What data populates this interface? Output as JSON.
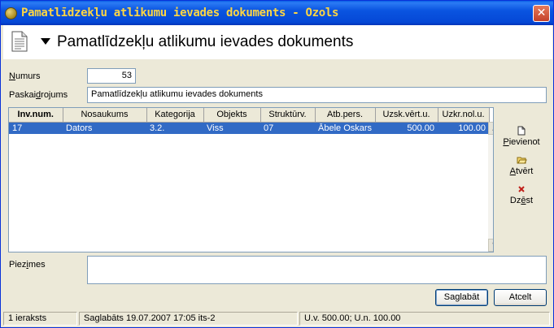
{
  "window": {
    "title": "Pamatlīdzekļu atlikumu ievades dokuments - Ozols",
    "close_glyph": "✕"
  },
  "header": {
    "heading": "Pamatlīdzekļu atlikumu ievades dokuments"
  },
  "form": {
    "numurs_label_pre": "",
    "numurs_label_u": "N",
    "numurs_label_post": "umurs",
    "numurs_value": "53",
    "paskaidrojums_label_pre": "Paskai",
    "paskaidrojums_label_u": "d",
    "paskaidrojums_label_post": "rojums",
    "paskaidrojums_value": "Pamatlīdzekļu atlikumu ievades dokuments",
    "piezimes_label_pre": "Piez",
    "piezimes_label_u": "i",
    "piezimes_label_post": "mes",
    "piezimes_value": ""
  },
  "grid": {
    "columns": [
      "Inv.num.",
      "Nosaukums",
      "Kategorija",
      "Objekts",
      "Struktūrv.",
      "Atb.pers.",
      "Uzsk.vērt.u.",
      "Uzkr.nol.u."
    ],
    "rows": [
      [
        "17",
        "Dators",
        "3.2.",
        "Viss",
        "07",
        "Ābele Oskars",
        "500.00",
        "100.00"
      ]
    ],
    "scroll_up": "▲",
    "scroll_down": "▼"
  },
  "toolbar": {
    "add_pre": "",
    "add_u": "P",
    "add_post": "ievienot",
    "open_pre": "",
    "open_u": "A",
    "open_post": "tvērt",
    "delete_pre": "Dz",
    "delete_u": "ē",
    "delete_post": "st"
  },
  "buttons": {
    "save_pre": "Sa",
    "save_u": "g",
    "save_post": "labāt",
    "cancel": "Atcelt"
  },
  "status": {
    "count": "1 ieraksts",
    "saved": "Saglabāts 19.07.2007 17:05 its-2",
    "totals": "U.v. 500.00; U.n. 100.00"
  },
  "colors": {
    "title_text": "#ffd642",
    "selection": "#316ac5"
  }
}
